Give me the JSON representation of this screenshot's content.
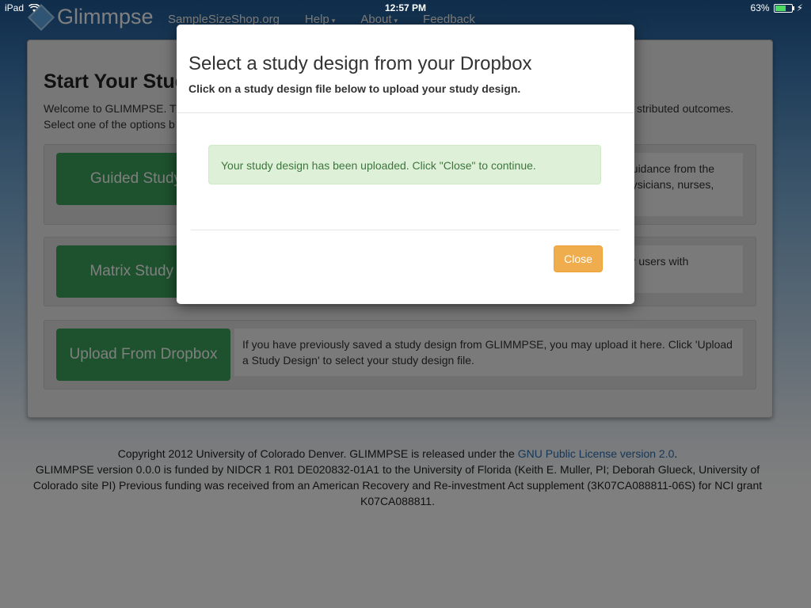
{
  "status_bar": {
    "device": "iPad",
    "time": "12:57 PM",
    "battery": "63%",
    "battery_level": 0.63
  },
  "navbar": {
    "brand": "Glimmpse",
    "links": [
      {
        "label": "SampleSizeShop.org"
      },
      {
        "label": "Help",
        "caret": "▾"
      },
      {
        "label": "About",
        "caret": "▾"
      },
      {
        "label": "Feedback"
      }
    ]
  },
  "main": {
    "title": "Start Your Stud",
    "intro_line1": "Welcome to GLIMMPSE. Th",
    "intro_line1_right": "stributed outcomes.",
    "intro_line2": "Select one of the options b",
    "options": [
      {
        "button": "Guided Study D",
        "desc_line1": "guidance from the",
        "desc_line2": "hysicians, nurses,"
      },
      {
        "button": "Matrix Study De",
        "desc_line1": "or users with"
      },
      {
        "button": "Upload From Dropbox",
        "desc": "If you have previously saved a study design from GLIMMPSE, you may upload it here. Click 'Upload a Study Design' to select your study design file."
      }
    ]
  },
  "footer": {
    "copyright_pre": "Copyright 2012 University of Colorado Denver. GLIMMPSE is released under the ",
    "license_link": "GNU Public License version 2.0",
    "copyright_post": ".",
    "funding": "GLIMMPSE version 0.0.0 is funded by NIDCR 1 R01 DE020832-01A1 to the University of Florida (Keith E. Muller, PI; Deborah Glueck, University of Colorado site PI) Previous funding was received from an American Recovery and Re-investment Act supplement (3K07CA088811-06S) for NCI grant K07CA088811."
  },
  "modal": {
    "title": "Select a study design from your Dropbox",
    "subtitle": "Click on a study design file below to upload your study design.",
    "alert": "Your study design has been uploaded. Click \"Close\" to continue.",
    "close_label": "Close"
  },
  "colors": {
    "primary_green": "#3da35d",
    "warning_orange": "#f0ad4e",
    "success_bg": "#dff0d8",
    "success_text": "#3c763d",
    "link_blue": "#2a6fb0"
  }
}
